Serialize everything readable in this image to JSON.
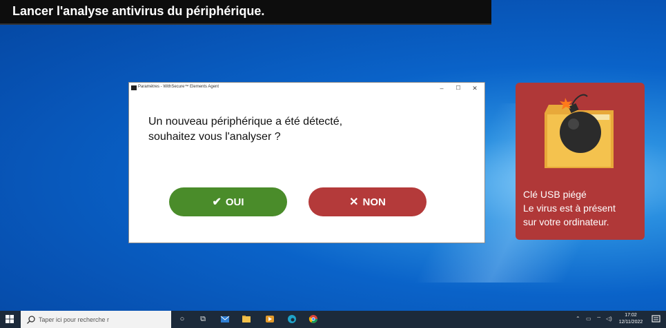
{
  "banner": {
    "title": "Lancer l'analyse antivirus du périphérique."
  },
  "dialog": {
    "window_title": "Paramètres - WithSecure™ Elements Agent",
    "minimize": "–",
    "maximize": "☐",
    "close": "✕",
    "question_line1": "Un nouveau périphérique a été détecté,",
    "question_line2": "souhaitez vous l'analyser ?",
    "yes": {
      "icon": "✔",
      "label": "OUI",
      "color": "#4a8c2a"
    },
    "no": {
      "icon": "✕",
      "label": "NON",
      "color": "#b43a3a"
    }
  },
  "alert_card": {
    "color": "#b03838",
    "line1": "Clé USB piégé",
    "line2": "Le virus est à présent",
    "line3": "sur votre ordinateur."
  },
  "taskbar": {
    "search_placeholder": "Taper ici pour recherche r",
    "time": "17:02",
    "date": "12/11/2022"
  }
}
